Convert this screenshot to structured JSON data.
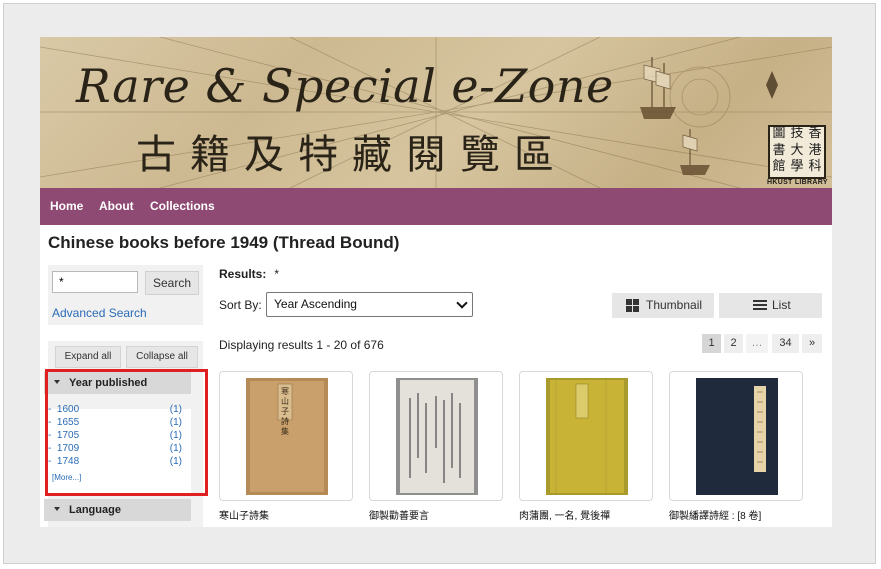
{
  "banner": {
    "title_en": "Rare & Special e-Zone",
    "title_zh": "古籍及特藏閱覽區",
    "logo_chars": [
      "圖",
      "技",
      "香",
      "書",
      "大",
      "港",
      "館",
      "學",
      "科"
    ],
    "logo_sub": "HKUST LIBRARY"
  },
  "nav": {
    "items": [
      "Home",
      "About",
      "Collections"
    ]
  },
  "page_title": "Chinese books before 1949 (Thread Bound)",
  "search": {
    "value": "*",
    "button": "Search",
    "advanced": "Advanced Search"
  },
  "facets": {
    "expand_all": "Expand all",
    "collapse_all": "Collapse all",
    "year": {
      "label": "Year published",
      "items": [
        {
          "year": "1600",
          "count": "(1)"
        },
        {
          "year": "1655",
          "count": "(1)"
        },
        {
          "year": "1705",
          "count": "(1)"
        },
        {
          "year": "1709",
          "count": "(1)"
        },
        {
          "year": "1748",
          "count": "(1)"
        }
      ],
      "more": "[More...]"
    },
    "language": {
      "label": "Language"
    }
  },
  "results": {
    "label": "Results:",
    "query": "*",
    "sort_label": "Sort By:",
    "sort_value": "Year Ascending",
    "view_thumbnail": "Thumbnail",
    "view_list": "List",
    "displaying": "Displaying results 1 - 20 of 676",
    "pagination": [
      "1",
      "2",
      "…",
      "34",
      "»"
    ],
    "items": [
      {
        "title": "寒山子詩集",
        "cover_color": "#b58a56",
        "cover_text": "寒山子詩集"
      },
      {
        "title": "御製勸善要言",
        "cover_color": "#d9d6cf",
        "cover_text": ""
      },
      {
        "title": "肉蒲團, 一名, 覺後禪",
        "cover_color": "#c8b337",
        "cover_text": ""
      },
      {
        "title": "御製繙譯詩經 : [8 卷]",
        "cover_color": "#1f2b3d",
        "cover_text": ""
      }
    ]
  },
  "colors": {
    "nav": "#8e4a72",
    "link": "#2a6bb6",
    "highlight": "#e02020"
  }
}
